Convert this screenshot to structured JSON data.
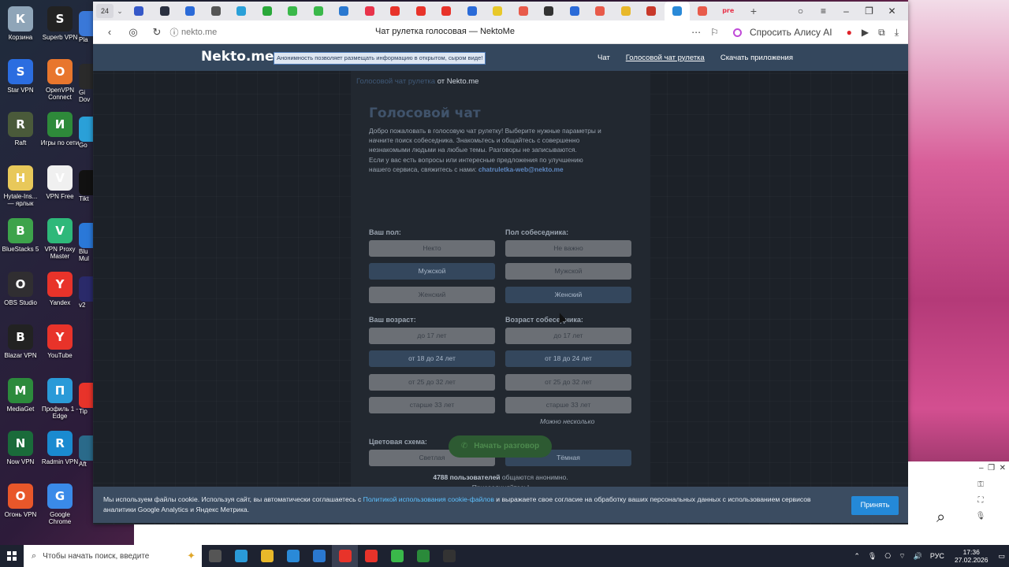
{
  "desktop": {
    "col1": [
      {
        "label": "Корзина",
        "icon": "trash-icon",
        "color": "#8fa5b8"
      },
      {
        "label": "Star VPN",
        "icon": "star-vpn-icon",
        "color": "#2b6de0"
      },
      {
        "label": "Raft",
        "icon": "raft-icon",
        "color": "#4a5a3a"
      },
      {
        "label": "Hytale-Ins... — ярлык",
        "icon": "file-icon",
        "color": "#e8c85a"
      },
      {
        "label": "BlueStacks 5",
        "icon": "bluestacks-icon",
        "color": "#3da34b"
      },
      {
        "label": "OBS Studio",
        "icon": "obs-icon",
        "color": "#302e31"
      },
      {
        "label": "Blazar VPN",
        "icon": "key-icon",
        "color": "#222"
      },
      {
        "label": "MediaGet",
        "icon": "mediaget-icon",
        "color": "#2c8a3c"
      },
      {
        "label": "Now VPN",
        "icon": "now-vpn-icon",
        "color": "#1a6b3a"
      },
      {
        "label": "Огонь VPN",
        "icon": "fire-icon",
        "color": "#e8572a"
      }
    ],
    "col2": [
      {
        "label": "Superb VPN",
        "icon": "superb-vpn-icon",
        "color": "#222"
      },
      {
        "label": "OpenVPN Connect",
        "icon": "openvpn-icon",
        "color": "#e8762d"
      },
      {
        "label": "Игры по сети",
        "icon": "ftp-icon",
        "color": "#2e8a3a"
      },
      {
        "label": "VPN Free",
        "icon": "file-icon",
        "color": "#f0f0f0"
      },
      {
        "label": "VPN Proxy Master",
        "icon": "vpn-proxy-icon",
        "color": "#2eb87a"
      },
      {
        "label": "Yandex",
        "icon": "yandex-icon",
        "color": "#e8332a"
      },
      {
        "label": "YouTube",
        "icon": "youtube-icon",
        "color": "#e8332a"
      },
      {
        "label": "Профиль 1 - Edge",
        "icon": "edge-icon",
        "color": "#2a9ad8"
      },
      {
        "label": "Radmin VPN",
        "icon": "radmin-icon",
        "color": "#1a8ad0"
      },
      {
        "label": "Google Chrome",
        "icon": "chrome-icon",
        "color": "#3a8ae8"
      }
    ],
    "col3": [
      "Pla",
      "Gi Dov",
      "Go",
      "Tikt",
      "Blu Mul",
      "v2",
      "Tip",
      "Aft"
    ]
  },
  "browser": {
    "tab_count": "24",
    "tabs": [
      {
        "icon": "app-icon",
        "color": "#3558c8"
      },
      {
        "icon": "app-icon",
        "color": "#2a3040"
      },
      {
        "icon": "app-icon",
        "color": "#2a6ad8"
      },
      {
        "icon": "app-icon",
        "color": "#555"
      },
      {
        "icon": "telegram-icon",
        "color": "#2aa0d8"
      },
      {
        "icon": "app-icon",
        "color": "#2aa83a"
      },
      {
        "icon": "app-icon",
        "color": "#3ab84a"
      },
      {
        "icon": "app-icon",
        "color": "#3ab84a"
      },
      {
        "icon": "vk-icon",
        "color": "#2a78d0"
      },
      {
        "icon": "app-icon",
        "color": "#e8334a"
      },
      {
        "icon": "youtube-icon",
        "color": "#e8332a"
      },
      {
        "icon": "youtube-icon",
        "color": "#e8332a"
      },
      {
        "icon": "youtube-icon",
        "color": "#e8332a"
      },
      {
        "icon": "app-icon",
        "color": "#2a6ad8"
      },
      {
        "icon": "app-icon",
        "color": "#e8c82a"
      },
      {
        "icon": "app-icon",
        "color": "#e85a4a"
      },
      {
        "icon": "app-icon",
        "color": "#333"
      },
      {
        "icon": "app-icon",
        "color": "#2a6ad8"
      },
      {
        "icon": "app-icon",
        "color": "#e85a4a"
      },
      {
        "icon": "app-icon",
        "color": "#e8b82a"
      },
      {
        "icon": "app-icon",
        "color": "#c8382a"
      },
      {
        "icon": "app-icon",
        "color": "#2a8ad8",
        "active": true
      },
      {
        "icon": "app-icon",
        "color": "#e85a4a"
      },
      {
        "icon": "app-icon",
        "color": "#e8334a",
        "text": "pre"
      }
    ],
    "url": "nekto.me",
    "page_title": "Чат рулетка голосовая — NektoMe",
    "alisa_label": "Спросить Алису AI"
  },
  "site": {
    "logo": "Nekto.me",
    "notice": "Анонимность позволяет размещать информацию в открытом, сыром виде!",
    "nav": [
      "Чат",
      "Голосовой чат рулетка",
      "Скачать приложения"
    ],
    "breadcrumb": {
      "link": "Голосовой чат рулетка",
      "rest": "от Nekto.me"
    },
    "title": "Голосовой чат",
    "intro1": "Добро пожаловать в голосовую чат рулетку! Выберите нужные параметры и начните поиск собеседника. Знакомьтесь и общайтесь с совершенно незнакомыми людьми на любые темы. Разговоры не записываются.",
    "intro2": "Если у вас есть вопросы или интересные предложения по улучшению нашего сервиса, свяжитесь с нами:",
    "email": "chatruletka-web@nekto.me",
    "your_gender_label": "Ваш пол:",
    "your_gender": [
      {
        "label": "Некто",
        "selected": false
      },
      {
        "label": "Мужской",
        "selected": true
      },
      {
        "label": "Женский",
        "selected": false
      }
    ],
    "partner_gender_label": "Пол собеседника:",
    "partner_gender": [
      {
        "label": "Не важно",
        "selected": false
      },
      {
        "label": "Мужской",
        "selected": false
      },
      {
        "label": "Женский",
        "selected": true
      }
    ],
    "your_age_label": "Ваш возраст:",
    "your_age": [
      {
        "label": "до 17 лет",
        "selected": false
      },
      {
        "label": "от 18 до 24 лет",
        "selected": true
      },
      {
        "label": "от 25 до 32 лет",
        "selected": false
      },
      {
        "label": "старше 33 лет",
        "selected": false
      }
    ],
    "partner_age_label": "Возраст собеседника:",
    "partner_age": [
      {
        "label": "до 17 лет",
        "selected": false
      },
      {
        "label": "от 18 до 24 лет",
        "selected": true
      },
      {
        "label": "от 25 до 32 лет",
        "selected": false
      },
      {
        "label": "старше 33 лет",
        "selected": false
      }
    ],
    "multi_hint": "Можно несколько",
    "scheme_label": "Цветовая схема:",
    "scheme": [
      {
        "label": "Светлая",
        "selected": false
      },
      {
        "label": "Тёмная",
        "selected": true
      }
    ],
    "start_label": "Начать разговор",
    "users_count": "4788 пользователей",
    "users_rest": "общаются анонимно.",
    "join": "Присоединяйтесь!"
  },
  "cookie": {
    "text_before": "Мы используем файлы cookie. Используя сайт, вы автоматически соглашаетесь с",
    "link": "Политикой использования cookie-файлов",
    "text_after": "и выражаете свое согласие на обработку ваших персональных данных с использованием сервисов аналитики Google Analytics и Яндекс Метрика.",
    "accept": "Принять"
  },
  "taskbar": {
    "search_placeholder": "Чтобы начать поиск, введите",
    "apps": [
      {
        "icon": "task-view-icon",
        "color": "#555"
      },
      {
        "icon": "edge-icon",
        "color": "#2a9ad8"
      },
      {
        "icon": "explorer-icon",
        "color": "#e8b82a"
      },
      {
        "icon": "store-icon",
        "color": "#2a8ad8"
      },
      {
        "icon": "mail-icon",
        "color": "#2a78d0"
      },
      {
        "icon": "yandex-browser-icon",
        "color": "#e8332a",
        "active": true
      },
      {
        "icon": "yandex-icon",
        "color": "#e8332a"
      },
      {
        "icon": "app-icon",
        "color": "#3ab84a"
      },
      {
        "icon": "xbox-icon",
        "color": "#2a8a3a"
      },
      {
        "icon": "github-icon",
        "color": "#333"
      }
    ],
    "lang": "РУС",
    "time": "17:36",
    "date": "27.02.2026"
  }
}
